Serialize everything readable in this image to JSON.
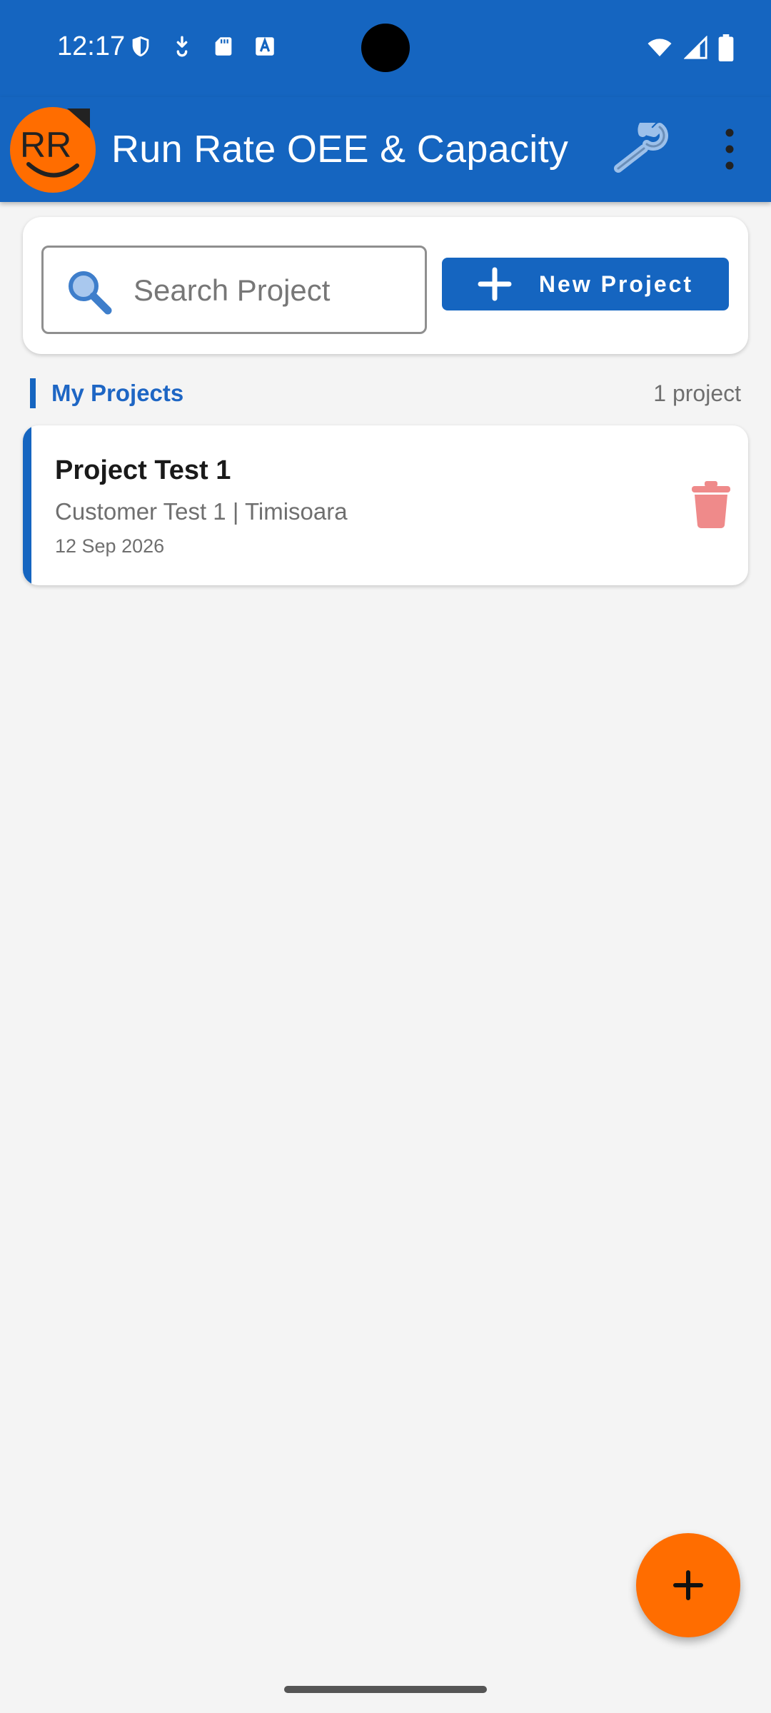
{
  "status_bar": {
    "time": "12:17",
    "icons": [
      "shield-icon",
      "download-icon",
      "sd-card-icon",
      "font-icon",
      "wifi-icon",
      "signal-icon",
      "battery-icon"
    ]
  },
  "app_bar": {
    "logo_text": "RR",
    "title": "Run Rate OEE & Capacity",
    "icons": [
      "wrench-icon",
      "more-vert-icon"
    ],
    "color": "#1565c0"
  },
  "search": {
    "placeholder": "Search Project",
    "value": ""
  },
  "new_project_button": {
    "label": "New Project"
  },
  "section": {
    "title": "My Projects",
    "count": "1 project"
  },
  "projects": [
    {
      "name": "Project Test 1",
      "subtitle": "Customer Test 1 | Timisoara",
      "date": "12 Sep 2026"
    }
  ],
  "colors": {
    "primary": "#1565c0",
    "accent": "#ff6d00",
    "delete": "#ef8a8a",
    "background": "#f4f4f4"
  }
}
